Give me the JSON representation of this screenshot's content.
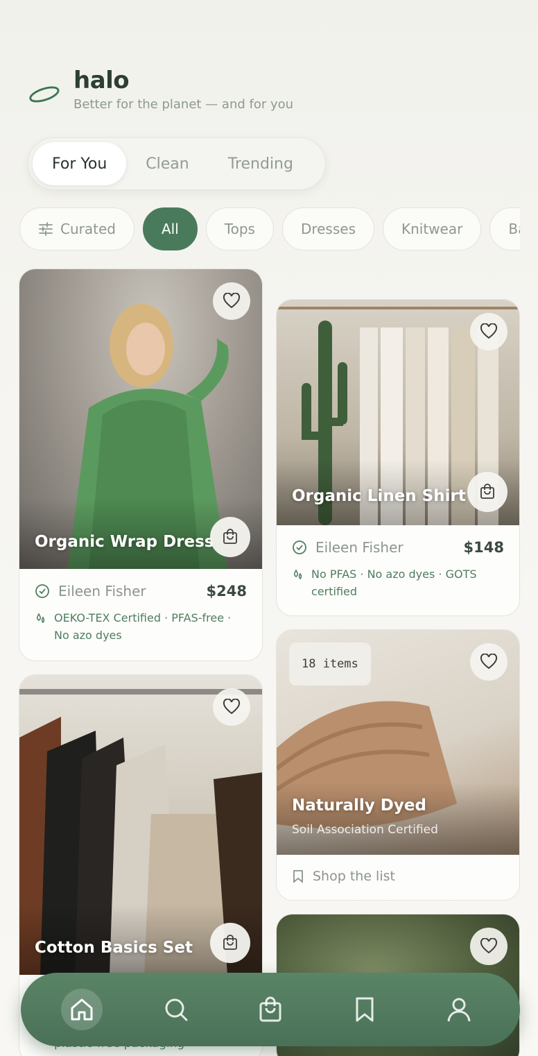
{
  "app": {
    "name": "halo",
    "tagline": "Better for the planet — and for you"
  },
  "tabs": [
    {
      "label": "For You",
      "active": true
    },
    {
      "label": "Clean",
      "active": false
    },
    {
      "label": "Trending",
      "active": false
    }
  ],
  "filters": [
    {
      "label": "Curated",
      "icon": "sliders-icon",
      "active": false
    },
    {
      "label": "All",
      "active": true
    },
    {
      "label": "Tops",
      "active": false
    },
    {
      "label": "Dresses",
      "active": false
    },
    {
      "label": "Knitwear",
      "active": false
    },
    {
      "label": "Ba",
      "active": false
    }
  ],
  "cards": {
    "wrap_dress": {
      "title": "Organic Wrap Dress",
      "brand": "Eileen Fisher",
      "price": "$248",
      "cert": "OEKO-TEX Certified · PFAS-free · No azo dyes"
    },
    "linen_shirt": {
      "title": "Organic Linen Shirt",
      "brand": "Eileen Fisher",
      "price": "$148",
      "cert": "No PFAS · No azo dyes · GOTS certified"
    },
    "naturally_dyed": {
      "count": "18 items",
      "title": "Naturally Dyed",
      "subtitle": "Soil Association Certified",
      "action": "Shop the list"
    },
    "cotton_basics": {
      "title": "Cotton Basics Set",
      "cert_peek": "plastic-free packaging"
    }
  },
  "nav": [
    {
      "icon": "home-icon",
      "active": true
    },
    {
      "icon": "search-icon",
      "active": false
    },
    {
      "icon": "bag-icon",
      "active": false
    },
    {
      "icon": "bookmark-icon",
      "active": false
    },
    {
      "icon": "profile-icon",
      "active": false
    }
  ],
  "colors": {
    "accent": "#4a7a5c",
    "text": "#2d3e33",
    "muted": "#8d998f",
    "cert": "#4f7d5f"
  }
}
